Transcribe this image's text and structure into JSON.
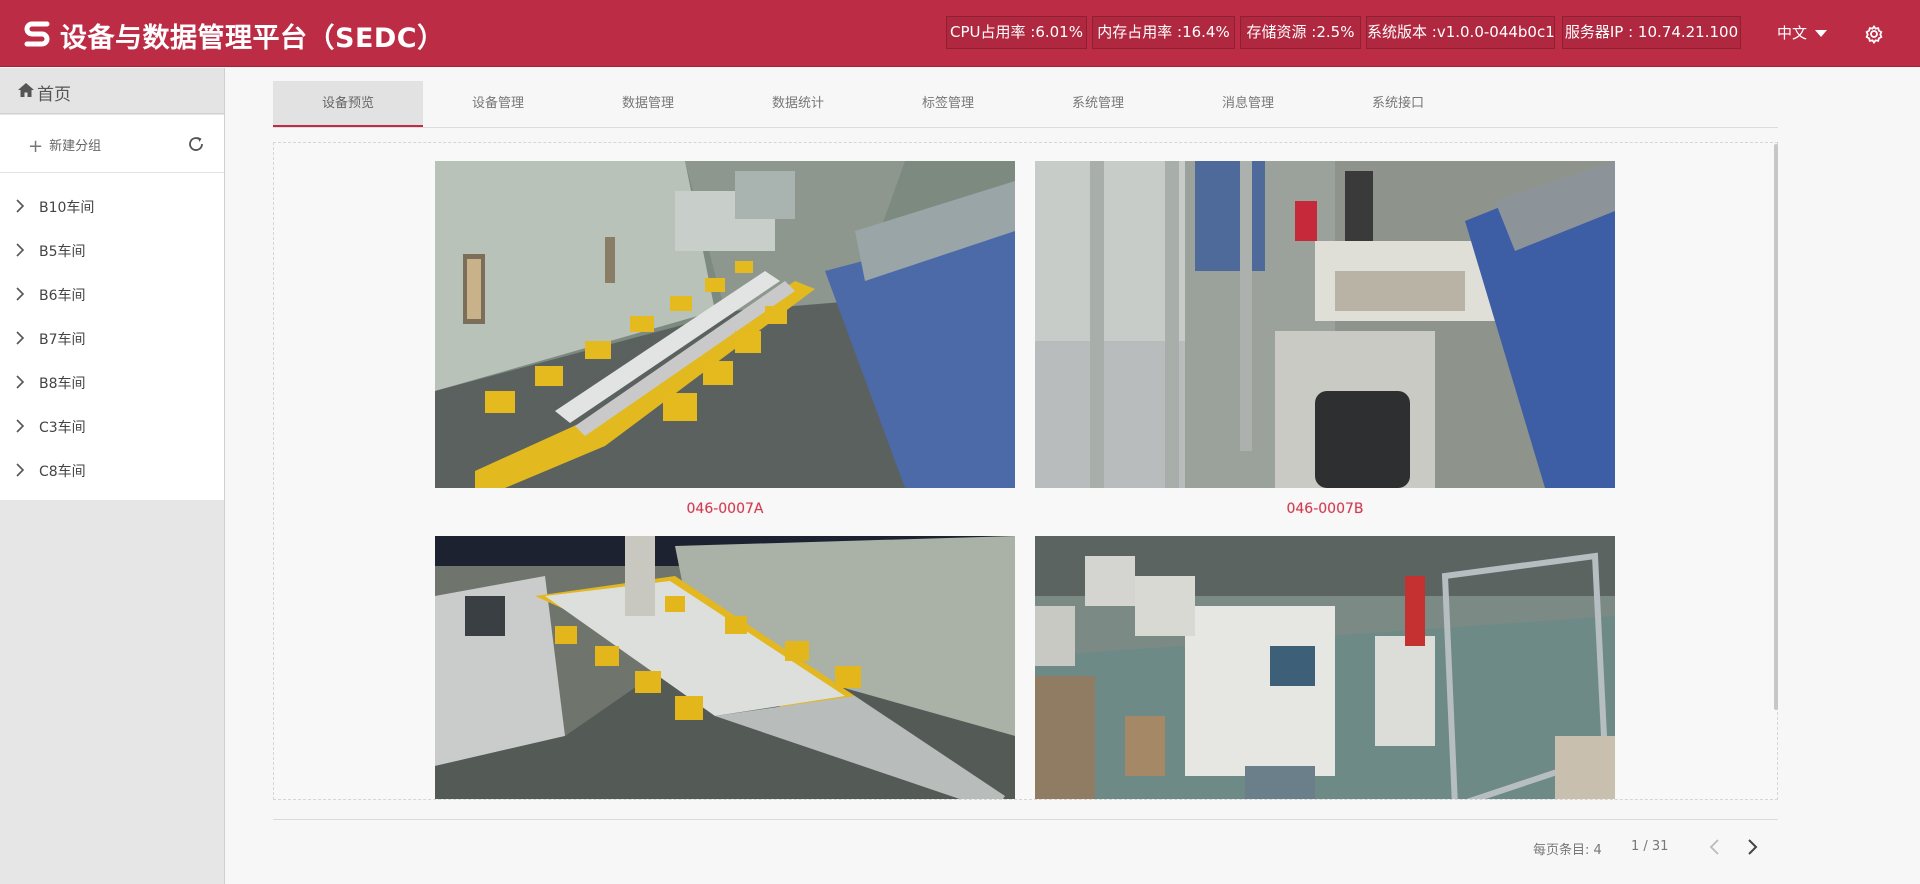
{
  "header": {
    "title": "设备与数据管理平台（SEDC）",
    "stats": [
      {
        "text": "CPU占用率 :6.01%"
      },
      {
        "text": "内存占用率 :16.4%"
      },
      {
        "text": "存储资源 :2.5%"
      },
      {
        "text": "系统版本 :v1.0.0-044b0c1"
      },
      {
        "text": "服务器IP : 10.74.21.100"
      }
    ],
    "language": "中文",
    "colors": {
      "brand": "#bd2c45",
      "accent_text": "#d13c52"
    }
  },
  "sidebar": {
    "home_label": "首页",
    "new_group_label": "新建分组",
    "items": [
      {
        "label": "B10车间"
      },
      {
        "label": "B5车间"
      },
      {
        "label": "B6车间"
      },
      {
        "label": "B7车间"
      },
      {
        "label": "B8车间"
      },
      {
        "label": "C3车间"
      },
      {
        "label": "C8车间"
      }
    ]
  },
  "tabs": [
    {
      "label": "设备预览"
    },
    {
      "label": "设备管理"
    },
    {
      "label": "数据管理"
    },
    {
      "label": "数据统计"
    },
    {
      "label": "标签管理"
    },
    {
      "label": "系统管理"
    },
    {
      "label": "消息管理"
    },
    {
      "label": "系统接口"
    }
  ],
  "devices": [
    {
      "caption": "046-0007A"
    },
    {
      "caption": "046-0007B"
    }
  ],
  "pagination": {
    "per_page": "每页条目: 4",
    "page": "1 / 31"
  }
}
